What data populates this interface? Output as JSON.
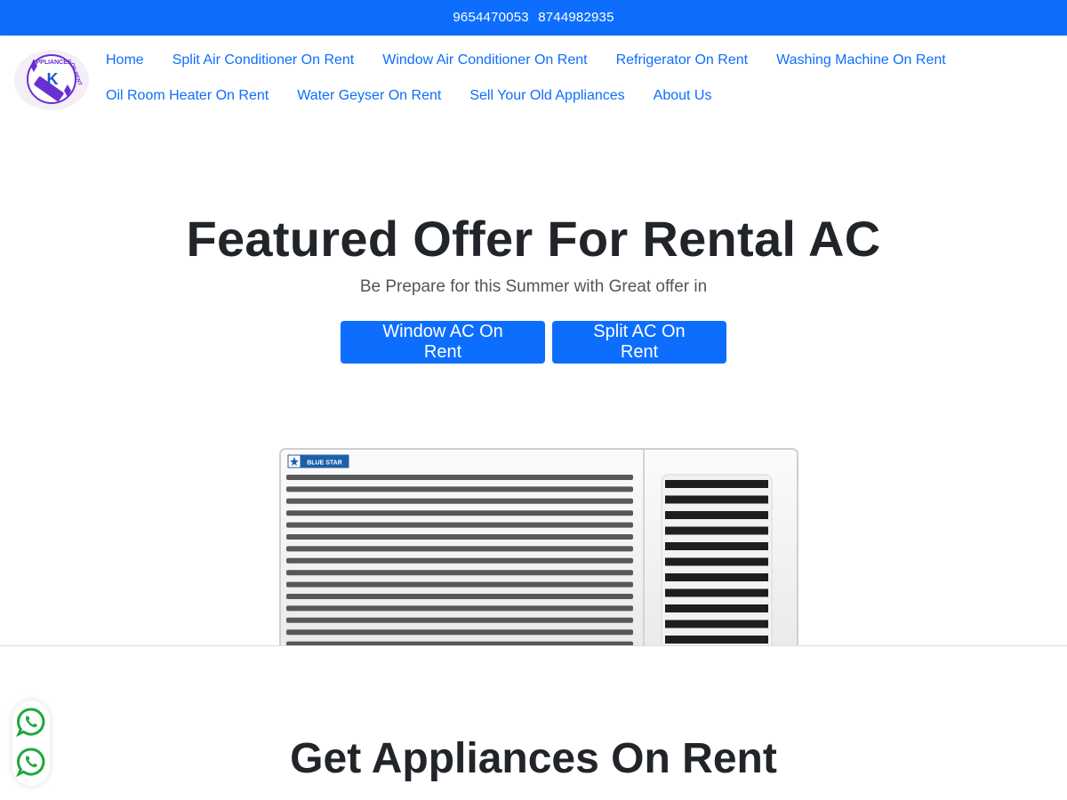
{
  "topbar": {
    "phone1": "9654470053",
    "phone2": "8744982935"
  },
  "logo": {
    "text_top": "APPLIANCES",
    "text_right": "ON RENT",
    "monogram": "K"
  },
  "nav": {
    "row1": [
      "Home",
      "Split Air Conditioner On Rent",
      "Window Air Conditioner On Rent",
      "Refrigerator On Rent",
      "Washing Machine On Rent"
    ],
    "row2": [
      "Oil Room Heater On Rent",
      "Water Geyser On Rent",
      "Sell Your Old Appliances",
      "About Us"
    ]
  },
  "hero": {
    "title": "Featured Offer For Rental AC",
    "subtitle": "Be Prepare for this Summer with Great offer in",
    "buttons": [
      "Window AC On Rent",
      "Split AC On Rent"
    ],
    "image_brand": "BLUE STAR"
  },
  "section": {
    "title": "Get Appliances On Rent"
  },
  "colors": {
    "primary": "#0d6efd",
    "whatsapp": "#1fa83d",
    "logo_purple": "#6a2fd1"
  },
  "icons": [
    "whatsapp-icon",
    "whatsapp-icon"
  ]
}
